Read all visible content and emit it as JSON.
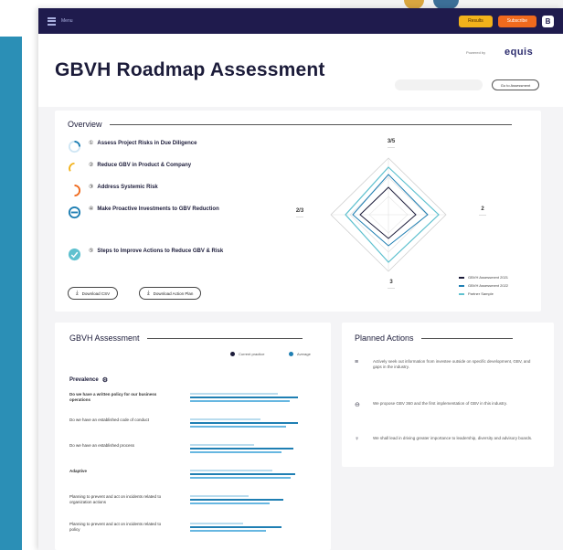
{
  "topbar": {
    "menu_label": "Menu",
    "btn_yellow": "Results",
    "btn_orange": "Subscribe",
    "user_initial": "B"
  },
  "header": {
    "title": "GBVH Roadmap Assessment",
    "powered_by": "Powered by",
    "brand": "equis",
    "search_placeholder": "",
    "pill_button": "Go to Assessment"
  },
  "overview": {
    "title": "Overview",
    "items": [
      {
        "num": "①",
        "label": "Assess Project Risks in Due Diligence"
      },
      {
        "num": "②",
        "label": "Reduce GBV in Product & Company"
      },
      {
        "num": "③",
        "label": "Address Systemic Risk"
      },
      {
        "num": "④",
        "label": "Make Proactive Investments to GBV Reduction"
      },
      {
        "num": "⑤",
        "label": "Steps to Improve Actions to Reduce GBV & Risk"
      }
    ],
    "buttons": {
      "download_csv": "Download CSV",
      "download_action": "Download Action Plan"
    },
    "radar": {
      "top_val": "3/5",
      "right_val": "2",
      "bottom_val": "3",
      "left_val": "2/3"
    },
    "legend": [
      "GBVH Assessment 2021",
      "GBVH Assessment 2022",
      "Partner Sample"
    ]
  },
  "assessment": {
    "title": "GBVH Assessment",
    "legend": [
      "Current practice",
      "Average"
    ],
    "subhead": "Prevalence",
    "rows": [
      {
        "label": "Do we have a written policy for our business operations",
        "bold": true,
        "vals": [
          0.75,
          0.92,
          0.85
        ]
      },
      {
        "label": "Do we have an established code of conduct",
        "bold": false,
        "vals": [
          0.6,
          0.92,
          0.82
        ]
      },
      {
        "label": "Do we have an established process",
        "bold": false,
        "vals": [
          0.55,
          0.88,
          0.78
        ]
      },
      {
        "label": "Adaptive",
        "bold": true,
        "vals": [
          0.7,
          0.9,
          0.86
        ]
      },
      {
        "label": "Planning to prevent and act on incidents related to organization actions",
        "bold": false,
        "vals": [
          0.5,
          0.8,
          0.68
        ]
      },
      {
        "label": "Planning to prevent and act on incidents related to policy",
        "bold": false,
        "vals": [
          0.45,
          0.78,
          0.65
        ]
      }
    ]
  },
  "planned": {
    "title": "Planned Actions",
    "items": [
      {
        "icon": "≡",
        "text": "Actively seek out information from investee outside on specific development, GBV, and gaps in the industry."
      },
      {
        "icon": "⊖",
        "text": "We propose GBV 360 and the first implementation of GBV in this industry."
      },
      {
        "icon": "♀",
        "text": "We shall lead in driving greater importance to leadership, diversity and advisory boards."
      }
    ]
  },
  "colors": {
    "navy": "#1f1b4d",
    "teal": "#5fc1cf",
    "blue": "#1f7fb3",
    "orange": "#f06a1d",
    "yellow": "#f2b21b"
  }
}
